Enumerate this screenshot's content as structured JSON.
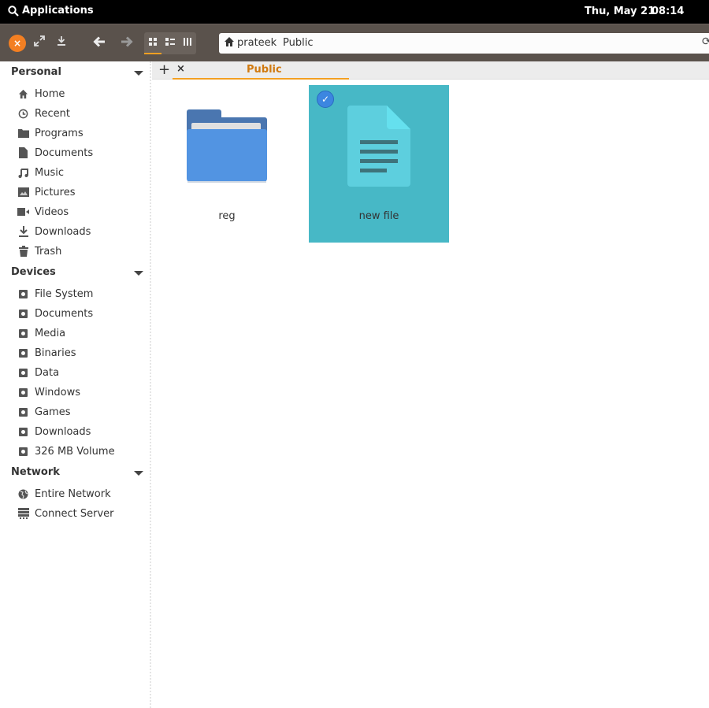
{
  "topbar": {
    "applications_label": "Applications",
    "date": "Thu, May 21",
    "time": "08:14"
  },
  "toolbar": {
    "close_icon": "×",
    "maximize_icon": "⤢",
    "download_icon": "⤓",
    "back_icon": "🡐",
    "forward_icon": "🡒",
    "view_icons": "▪▪",
    "view_list": "☰",
    "view_columns": "|||",
    "active_view": "icons"
  },
  "address": {
    "home_icon": "⌂",
    "crumbs": [
      "prateek",
      "Public"
    ],
    "refresh_icon": "⟳"
  },
  "sidebar": {
    "sections": [
      {
        "title": "Personal",
        "items": [
          {
            "label": "Home",
            "icon": "home-icon"
          },
          {
            "label": "Recent",
            "icon": "clock-icon"
          },
          {
            "label": "Programs",
            "icon": "folder-icon"
          },
          {
            "label": "Documents",
            "icon": "document-icon"
          },
          {
            "label": "Music",
            "icon": "music-icon"
          },
          {
            "label": "Pictures",
            "icon": "picture-icon"
          },
          {
            "label": "Videos",
            "icon": "video-icon"
          },
          {
            "label": "Downloads",
            "icon": "download-icon"
          },
          {
            "label": "Trash",
            "icon": "trash-icon"
          }
        ]
      },
      {
        "title": "Devices",
        "items": [
          {
            "label": "File System",
            "icon": "disk-icon"
          },
          {
            "label": "Documents",
            "icon": "disk-icon"
          },
          {
            "label": "Media",
            "icon": "disk-icon"
          },
          {
            "label": "Binaries",
            "icon": "disk-icon"
          },
          {
            "label": "Data",
            "icon": "disk-icon"
          },
          {
            "label": "Windows",
            "icon": "disk-icon"
          },
          {
            "label": "Games",
            "icon": "disk-icon"
          },
          {
            "label": "Downloads",
            "icon": "disk-icon"
          },
          {
            "label": "326 MB Volume",
            "icon": "disk-icon"
          }
        ]
      },
      {
        "title": "Network",
        "items": [
          {
            "label": "Entire Network",
            "icon": "globe-icon"
          },
          {
            "label": "Connect Server",
            "icon": "server-icon"
          }
        ]
      }
    ]
  },
  "tabs": {
    "add_icon": "+",
    "close_icon": "×",
    "items": [
      {
        "label": "Public",
        "active": true
      }
    ]
  },
  "files": [
    {
      "name": "reg",
      "type": "folder",
      "selected": false
    },
    {
      "name": "new file",
      "type": "text",
      "selected": true
    }
  ],
  "colors": {
    "accent": "#f3a022",
    "selection": "#47b8c6",
    "toolbar": "#5a524c",
    "folder": "#5294e2"
  }
}
